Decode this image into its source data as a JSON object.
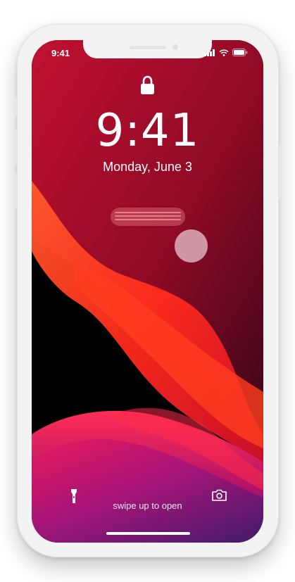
{
  "status_bar": {
    "time": "9:41"
  },
  "lock_screen": {
    "clock": "9:41",
    "date": "Monday, June 3",
    "swipe_hint": "swipe up to open"
  },
  "icons": {
    "lock": "lock-icon",
    "flashlight": "flashlight-icon",
    "camera": "camera-icon",
    "signal": "cellular-signal-icon",
    "wifi": "wifi-icon",
    "battery": "battery-icon"
  },
  "colors": {
    "wallpaper_dark": "#3a0618",
    "wallpaper_red": "#c8102e",
    "wallpaper_orange": "#ff3d1f",
    "wallpaper_magenta": "#b5166a",
    "wallpaper_purple": "#4a1a6e"
  }
}
